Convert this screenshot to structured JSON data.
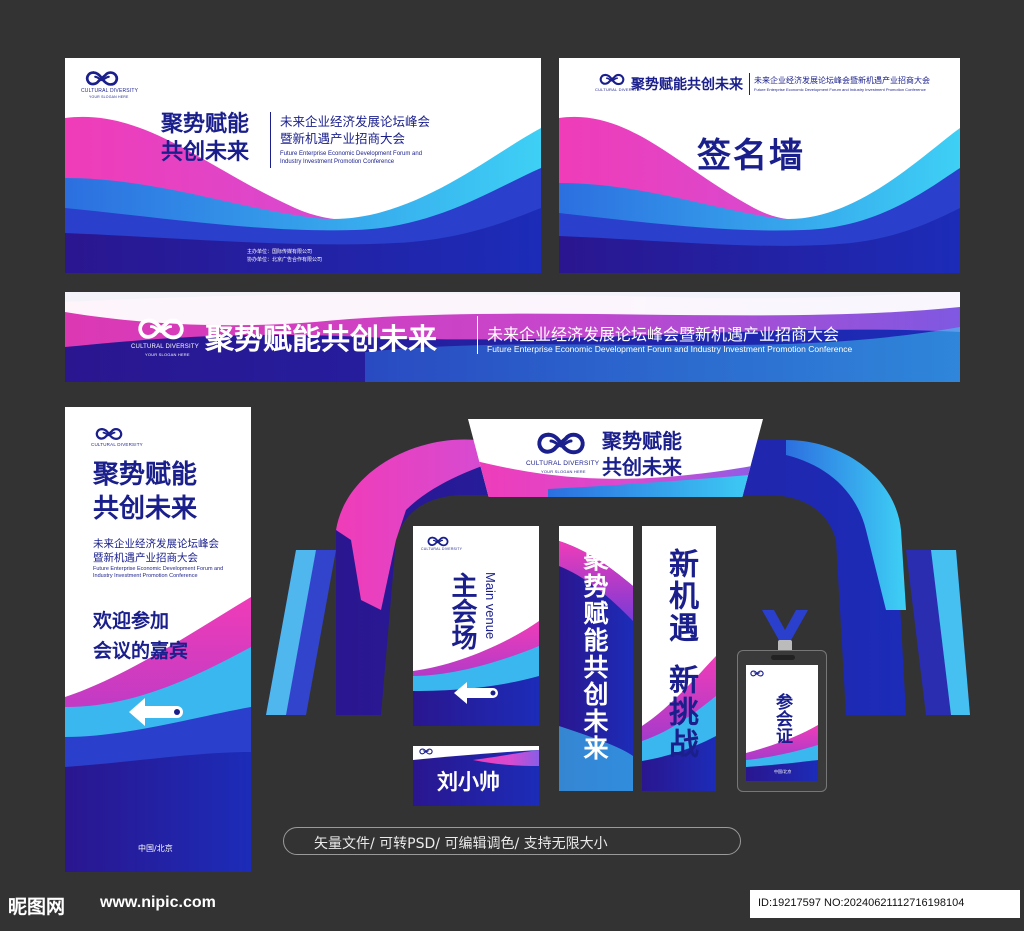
{
  "colors": {
    "navy": "#1a1f8c",
    "magenta": "#e02fb4",
    "cyan": "#36c3f0",
    "background": "#333333"
  },
  "logo": {
    "name": "CULTURAL DIVERSITY",
    "slogan": "YOUR SLOGAN HERE",
    "icon": "infinity-icon"
  },
  "slogan_cn": "聚势赋能共创未来",
  "slogan_line1": "聚势赋能",
  "slogan_line2": "共创未来",
  "event_cn": "未来企业经济发展论坛峰会暨新机遇产业招商大会",
  "event_cn_line1": "未来企业经济发展论坛峰会",
  "event_cn_line2": "暨新机遇产业招商大会",
  "event_en": "Future Enterprise Economic Development Forum and Industry Investment Promotion Conference",
  "event_en_line1": "Future Enterprise Economic Development Forum and",
  "event_en_line2": "Industry Investment Promotion Conference",
  "organizers": {
    "host": "主办单位：国际传媒有限公司",
    "co": "协办单位：北京广告合作有限公司"
  },
  "signwall": {
    "title": "签名墙"
  },
  "standee": {
    "welcome_line1": "欢迎参加",
    "welcome_line2": "会议的嘉宾",
    "location": "中国/北京",
    "arrow_icon": "arrow-left-icon"
  },
  "venue_sign": {
    "title": "主会场",
    "en": "Main venue",
    "arrow_icon": "arrow-left-icon"
  },
  "nameplate": {
    "name": "刘小帅"
  },
  "banner_new": {
    "line1": "新机遇",
    "line2": "新挑战"
  },
  "badge": {
    "title": "参会证",
    "location": "中国/北京"
  },
  "caption": "矢量文件/ 可转PSD/ 可编辑调色/ 支持无限大小",
  "watermark": {
    "site_cn": "昵图网",
    "site_url": "www.nipic.com",
    "id": "ID:19217597 NO:20240621112716198104"
  }
}
